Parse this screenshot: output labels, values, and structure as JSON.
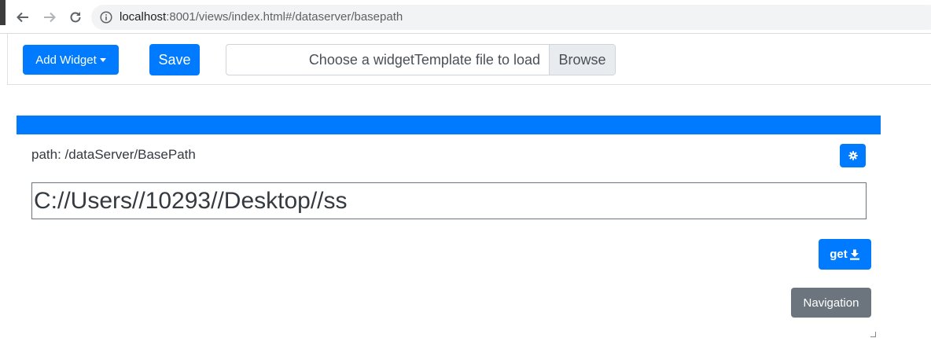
{
  "browser": {
    "url_host": "localhost",
    "url_rest": ":8001/views/index.html#/dataserver/basepath",
    "icons": [
      "back-arrow-icon",
      "forward-arrow-icon",
      "reload-icon",
      "info-icon"
    ]
  },
  "toolbar": {
    "add_widget_label": "Add Widget",
    "save_label": "Save",
    "file_placeholder": "Choose a widgetTemplate file to load",
    "browse_label": "Browse"
  },
  "widget": {
    "path_label": "path: /dataServer/BasePath",
    "path_value": "C://Users//10293//Desktop//ss",
    "get_label": "get",
    "navigation_label": "Navigation"
  },
  "colors": {
    "primary": "#007bff",
    "secondary": "#6c757d"
  }
}
